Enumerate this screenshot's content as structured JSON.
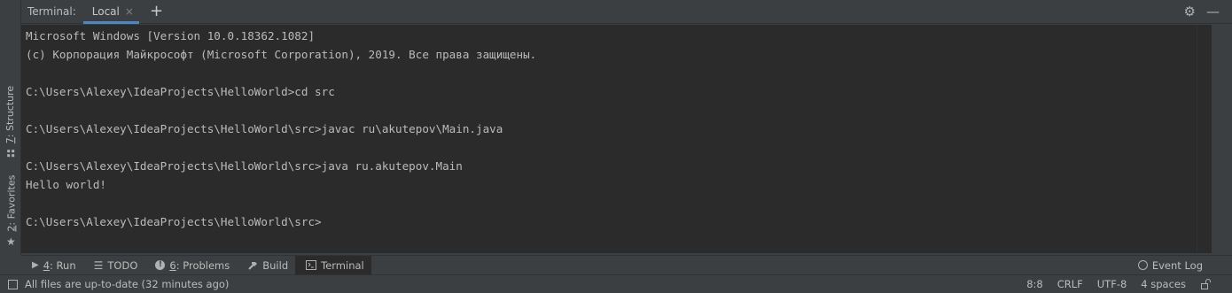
{
  "left_stripe": {
    "structure": {
      "num": "7",
      "label": ": Structure"
    },
    "favorites": {
      "num": "2",
      "label": ": Favorites"
    }
  },
  "header": {
    "title": "Terminal:",
    "tab_label": "Local",
    "close_glyph": "×",
    "add_glyph": "+",
    "settings_glyph": "⚙",
    "hide_glyph": "—"
  },
  "terminal": {
    "lines": [
      "Microsoft Windows [Version 10.0.18362.1082]",
      "(c) Корпорация Майкрософт (Microsoft Corporation), 2019. Все права защищены.",
      "",
      "C:\\Users\\Alexey\\IdeaProjects\\HelloWorld>cd src",
      "",
      "C:\\Users\\Alexey\\IdeaProjects\\HelloWorld\\src>javac ru\\akutepov\\Main.java",
      "",
      "C:\\Users\\Alexey\\IdeaProjects\\HelloWorld\\src>java ru.akutepov.Main",
      "Hello world!",
      "",
      "C:\\Users\\Alexey\\IdeaProjects\\HelloWorld\\src>"
    ]
  },
  "tool_tabs": {
    "run": {
      "num": "4",
      "label": ": Run"
    },
    "todo": {
      "label": "TODO"
    },
    "problems": {
      "num": "6",
      "label": ": Problems"
    },
    "build": {
      "label": "Build"
    },
    "terminal": {
      "label": "Terminal"
    },
    "event_log": {
      "label": "Event Log"
    }
  },
  "status": {
    "message": "All files are up-to-date (32 minutes ago)",
    "position": "8:8",
    "line_sep": "CRLF",
    "encoding": "UTF-8",
    "indent": "4 spaces"
  },
  "colors": {
    "accent": "#4a88c7",
    "terminal_bg": "#2b2b2b",
    "panel_bg": "#3c3f41"
  }
}
